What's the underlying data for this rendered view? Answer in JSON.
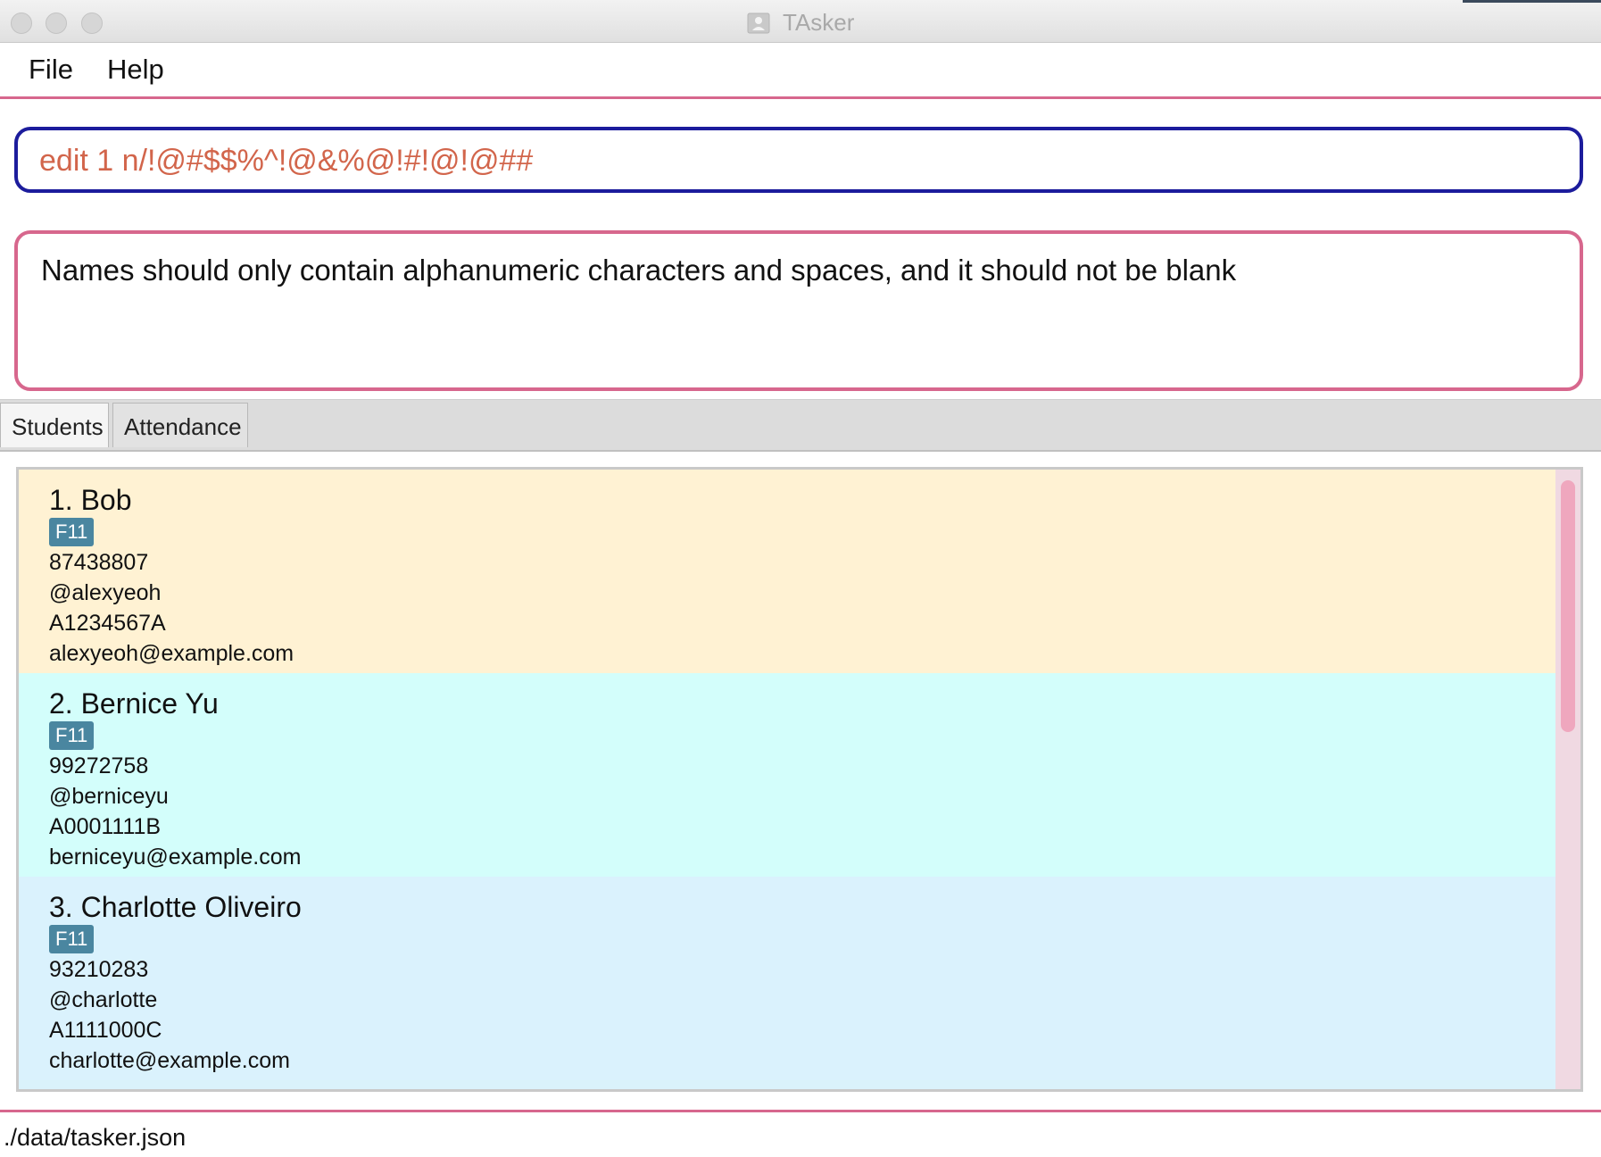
{
  "window": {
    "title": "TAsker"
  },
  "menu": {
    "items": [
      "File",
      "Help"
    ]
  },
  "command": {
    "value": "edit 1 n/!@#$$%^!@&%@!#!@!@##"
  },
  "result": {
    "message": "Names should only contain alphanumeric characters and spaces, and it should not be blank"
  },
  "tabs": [
    {
      "label": "Students",
      "active": true
    },
    {
      "label": "Attendance",
      "active": false
    }
  ],
  "students": [
    {
      "name": "1.  Bob",
      "tag": "F11",
      "phone": "87438807",
      "telegram": "@alexyeoh",
      "matric": "A1234567A",
      "email": "alexyeoh@example.com",
      "bg": "#fff2d3"
    },
    {
      "name": "2.  Bernice Yu",
      "tag": "F11",
      "phone": "99272758",
      "telegram": "@berniceyu",
      "matric": "A0001111B",
      "email": "berniceyu@example.com",
      "bg": "#d3fefb"
    },
    {
      "name": "3.  Charlotte Oliveiro",
      "tag": "F11",
      "phone": "93210283",
      "telegram": "@charlotte",
      "matric": "A1111000C",
      "email": "charlotte@example.com",
      "bg": "#daf2fd"
    }
  ],
  "status": {
    "path": "./data/tasker.json"
  },
  "colors": {
    "accent": "#d7678d",
    "command_border": "#1c1c9c",
    "command_text": "#d2654b",
    "tag_bg": "#4a86a0"
  }
}
